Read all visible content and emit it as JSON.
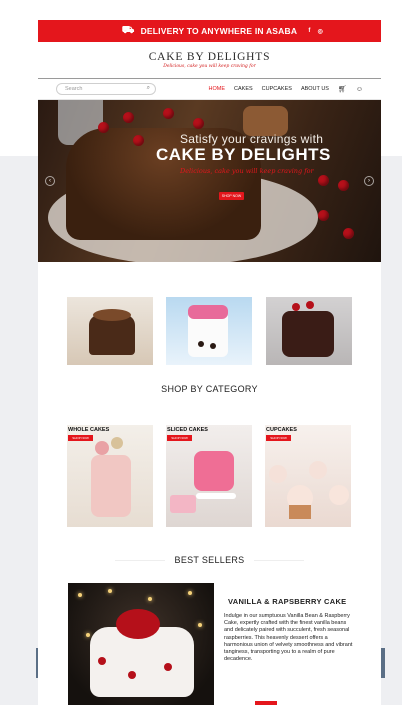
{
  "promo": {
    "text": "DELIVERY TO ANYWHERE IN ASABA",
    "truck_icon": "truck-icon",
    "social_icons": [
      "facebook-icon",
      "instagram-icon"
    ],
    "bg": "#e4161c"
  },
  "brand": {
    "name": "CAKE BY DELIGHTS",
    "tagline": "Delicious, cake you will keep craving for"
  },
  "nav": {
    "search_placeholder": "Search",
    "items": [
      "HOME",
      "CAKES",
      "CUPCAKES",
      "ABOUT US"
    ],
    "active": "HOME",
    "icons": [
      "cart-icon",
      "user-icon"
    ]
  },
  "hero": {
    "line1": "Satisfy your cravings with",
    "line2": "CAKE BY DELIGHTS",
    "line3": "Delicious, cake you will keep craving for",
    "button": "SHOP NOW"
  },
  "shop_by_category": {
    "title": "SHOP BY CATEGORY",
    "categories": [
      {
        "label": "WHOLE CAKES",
        "button": "SHOP NOW"
      },
      {
        "label": "SLICED CAKES",
        "button": "SHOP NOW"
      },
      {
        "label": "CUPCAKES",
        "button": "SHOP NOW"
      }
    ]
  },
  "best_sellers": {
    "title": "BEST SELLERS",
    "product": {
      "name": "VANILLA & RAPSBERRY CAKE",
      "description": "Indulge in our sumptuous Vanilla Bean & Raspberry Cake, expertly crafted with the finest vanilla beans and delicately paired with succulent, fresh seasonal raspberries. This heavenly dessert offers a harmonious union of velvety smoothness and vibrant tanginess, transporting you to a realm of pure decadence."
    }
  },
  "colors": {
    "accent": "#e4161c",
    "band": "#eeeff2"
  }
}
